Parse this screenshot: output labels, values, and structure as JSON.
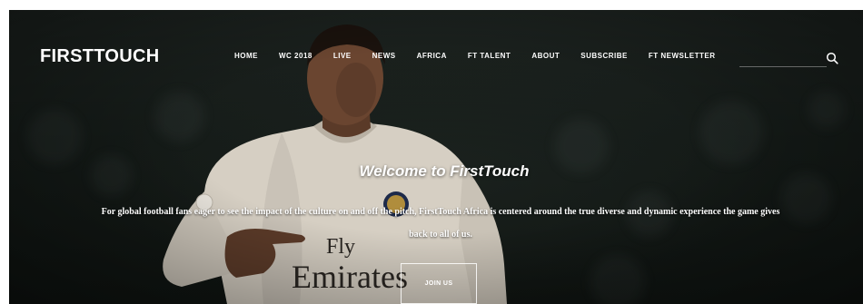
{
  "brand": {
    "name": "FIRSTTOUCH"
  },
  "nav": {
    "items": [
      {
        "label": "HOME"
      },
      {
        "label": "WC 2018"
      },
      {
        "label": "LIVE"
      },
      {
        "label": "NEWS"
      },
      {
        "label": "AFRICA"
      },
      {
        "label": "FT TALENT"
      },
      {
        "label": "ABOUT"
      },
      {
        "label": "SUBSCRIBE"
      },
      {
        "label": "FT NEWSLETTER"
      }
    ]
  },
  "search": {
    "placeholder": "",
    "icon": "search-icon"
  },
  "hero": {
    "title": "Welcome to FirstTouch",
    "description": "For global football fans eager to see the impact of the culture on and off the pitch, FirstTouch Africa is centered around the true diverse and dynamic experience the game gives back to all of us.",
    "cta_label": "JOIN US",
    "shirt_text": "Fly Emirates"
  },
  "colors": {
    "text": "#ffffff",
    "background": "#141a17",
    "shirt": "#d9d2c6"
  }
}
